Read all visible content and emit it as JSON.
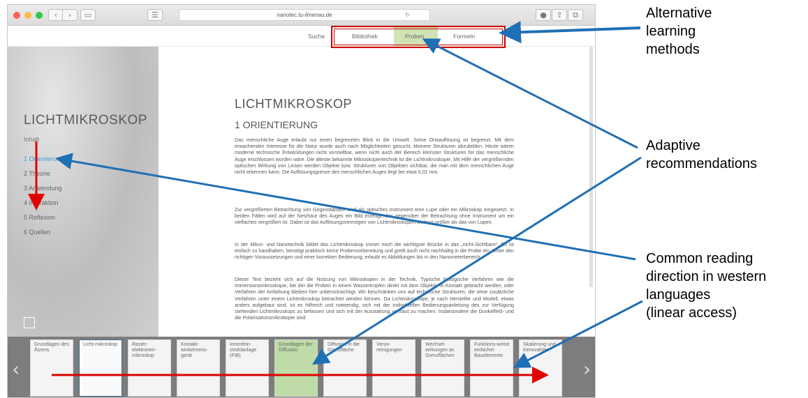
{
  "browser": {
    "url": "nanotec.tu-ilmenau.de"
  },
  "site_nav": {
    "items": [
      "Suche",
      "Bibliothek",
      "Proben",
      "Formeln"
    ],
    "highlight_color": "#cfe3b4"
  },
  "sidebar": {
    "title": "LICHTMIKROSKOP",
    "toc_heading": "Inhalt",
    "items": [
      "1 Orientierung",
      "2 Theorie",
      "3 Anwendung",
      "4 Interaktion",
      "5 Reflexion",
      "6 Quellen"
    ]
  },
  "article": {
    "title": "LICHTMIKROSKOP",
    "section": "1 ORIENTIERUNG",
    "paragraphs": [
      "Das menschliche Auge erlaubt nur einen begrenzten Blick in die Umwelt. Seine Ortsauflösung ist begrenzt. Mit dem erwachenden Interesse für die Natur wurde auch nach Möglichkeiten gesucht, kleinere Strukturen abzubilden. Heute wären moderne technische Entwicklungen nicht vorstellbar, wenn nicht auch der Bereich kleinster Strukturen für das menschliche Auge erschlossen worden wäre. Die älteste bekannte Mikroskopiertechnik ist die Lichtmikroskopie. Mit Hilfe der vergrößernden optischen Wirkung von Linsen werden Objekte bzw. Strukturen von Objekten sichtbar, die man mit dem menschlichen Auge nicht erkennen kann. Die Auflösungsgrenze des menschlichen Auges liegt bei etwa 0,02 mm.",
      "Zur vergrößerten Betrachtung von Gegenständen wird als optisches Instrument eine Lupe oder ein Mikroskop eingesetzt. In beiden Fällen wird auf der Netzhaut des Auges ein Bild erzeugt, das gegenüber der Betrachtung ohne Instrument um ein vielfaches vergrößert ist. Dabei ist das Auflösungsvermögen von Lichtmikroskopen weitaus größer als das von Lupen.",
      "In der Mikro- und Nanotechnik bildet das Lichtmikroskop immer noch die wichtigste Brücke in das „nicht-Sichtbare\". Es ist einfach zu handhaben, benötigt praktisch keine Probenvorbereitung und greift auch nicht nachhaltig in die Probe ein. Unter den richtigen Voraussetzungen und einer korrekten Bedienung, erlaubt es Abbildungen bis in den Nanometerbereich.",
      "Dieser Text bezieht sich auf die Nutzung von Mikroskopen in der Technik. Typische biologische Verfahren wie die Immersionsmikroskopie, bei der die Proben in einem Wassertropfen direkt mit dem Objektiv in Kontakt gebracht werden, oder Verfahren der Anfärbung bleiben hier unberücksichtigt. Wir beschränken uns auf technische Strukturen, die ohne zusätzliche Verfahren unter einem Lichtmikroskop betrachtet werden können. Da Lichtmikroskope, je nach Hersteller und Modell, etwas anders aufgebaut sind, ist es hilfreich und notwendig, sich mit der individuellen Bedienungsanleitung des zur Verfügung stehenden Lichtmikroskops zu befassen und sich mit der Ausstattung vertraut zu machen. Insbesondere die Dunkelfeld- und die Polarisationsmikrokopie sind"
    ]
  },
  "carousel": {
    "cards": [
      {
        "label": "Grundlagen des Ätzens",
        "state": "normal"
      },
      {
        "label": "Licht-mikroskop",
        "state": "selected"
      },
      {
        "label": "Raster-elektronen-mikroskop",
        "state": "normal"
      },
      {
        "label": "Kontakt-winkelmess-gerät",
        "state": "normal"
      },
      {
        "label": "Ionenfein-strahlanlage (FIB)",
        "state": "normal"
      },
      {
        "label": "Grundlagen der Diffusion",
        "state": "recommended"
      },
      {
        "label": "Diffusion in die Grenzfläche",
        "state": "normal"
      },
      {
        "label": "Verun-reinigungen",
        "state": "normal"
      },
      {
        "label": "Wechsel-wirkungen an Grenzflächen",
        "state": "normal"
      },
      {
        "label": "Funktions-weise einfacher Bauelemente",
        "state": "normal"
      },
      {
        "label": "Skalierung und Kennzahlen",
        "state": "normal"
      }
    ]
  },
  "annotations": {
    "alt_learning": [
      "Alternative",
      "learning",
      "methods"
    ],
    "adaptive": [
      "Adaptive",
      "recommendations"
    ],
    "reading": [
      "Common reading",
      "direction in western",
      "languages",
      "(linear access)"
    ],
    "colors": {
      "arrow_blue": "#1f6fb4",
      "arrow_red": "#e00000"
    }
  }
}
